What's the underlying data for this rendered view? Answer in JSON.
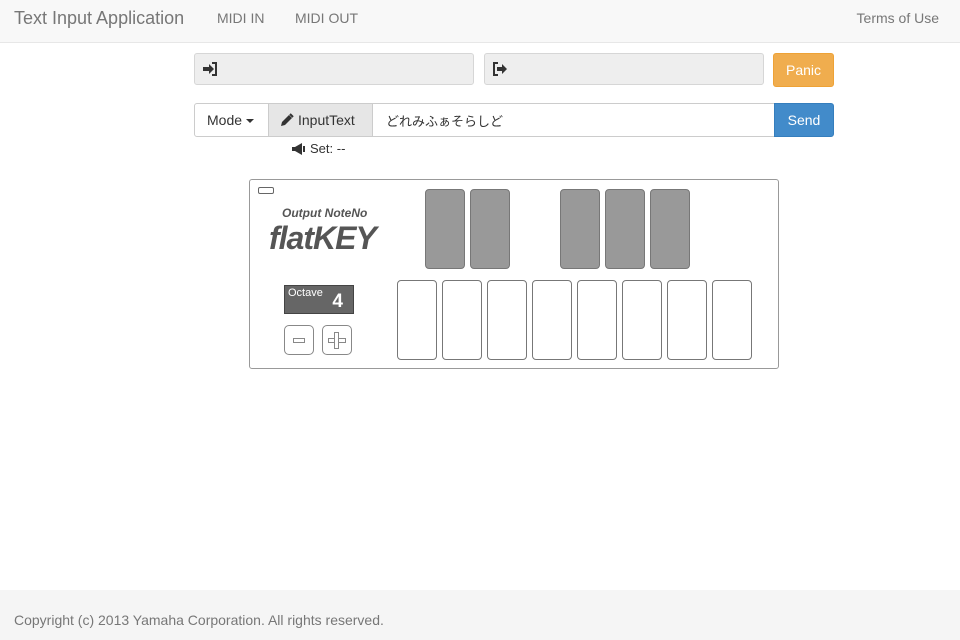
{
  "app": {
    "title": "Text Input Application",
    "nav": {
      "midi_in": "MIDI IN",
      "midi_out": "MIDI OUT",
      "terms": "Terms of Use"
    }
  },
  "midi": {
    "in_icon": "sign-in-icon",
    "out_icon": "sign-out-icon",
    "in_value": "",
    "out_value": ""
  },
  "toolbar": {
    "panic_label": "Panic",
    "mode_label": "Mode",
    "inputtext_label": "InputText",
    "text_value": "どれみふぁそらしど",
    "send_label": "Send",
    "set_status": "Set: --"
  },
  "flatkey": {
    "output_label": "Output NoteNo",
    "logo": "flatKEY",
    "octave_label": "Octave",
    "octave_value": "4",
    "black_keys": 5,
    "white_keys": 8
  },
  "colors": {
    "panic": "#f0ad4e",
    "send": "#428bca",
    "octave_bg": "#666666",
    "black_key": "#999999"
  },
  "footer": {
    "copyright": "Copyright (c) 2013 Yamaha Corporation. All rights reserved."
  }
}
